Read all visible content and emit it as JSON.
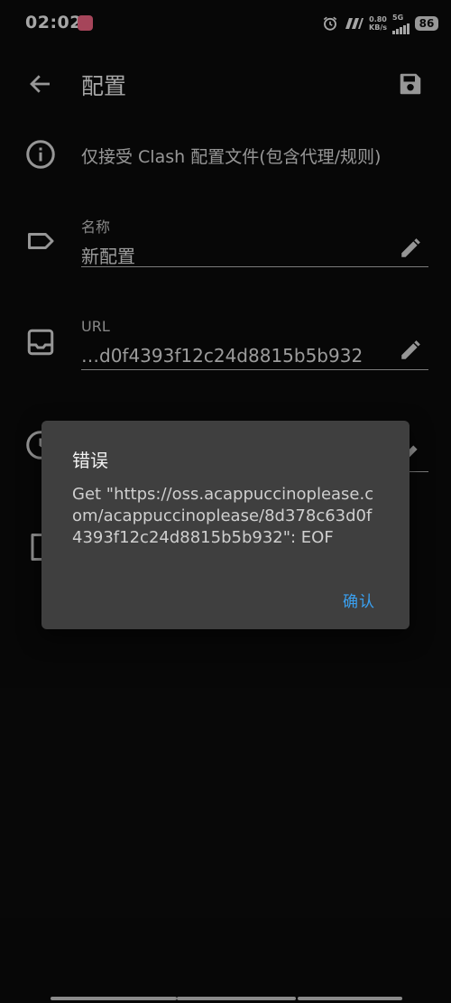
{
  "status_bar": {
    "time": "02:02",
    "net_speed_value": "0.80",
    "net_speed_unit": "KB/s",
    "network_type": "5G",
    "battery": "86"
  },
  "app_bar": {
    "title": "配置",
    "back_icon": "arrow-left-icon",
    "save_icon": "floppy-disk-icon"
  },
  "info": {
    "text": "仅接受 Clash 配置文件(包含代理/规则)",
    "icon": "info-icon"
  },
  "fields": {
    "name": {
      "label": "名称",
      "value": "新配置",
      "icon": "label-tag-icon"
    },
    "url": {
      "label": "URL",
      "value": "…d0f4393f12c24d8815b5b932",
      "icon": "inbox-tray-icon"
    }
  },
  "dialog": {
    "title": "错误",
    "message": "Get \"https://oss.acappuccinoplease.com/acappuccinoplease/8d378c63d0f4393f12c24d8815b5b932\": EOF",
    "confirm_label": "确认"
  },
  "colors": {
    "background": "#0c0c0c",
    "dialog_bg": "#3f3f3f",
    "accent": "#3aa0f0"
  }
}
